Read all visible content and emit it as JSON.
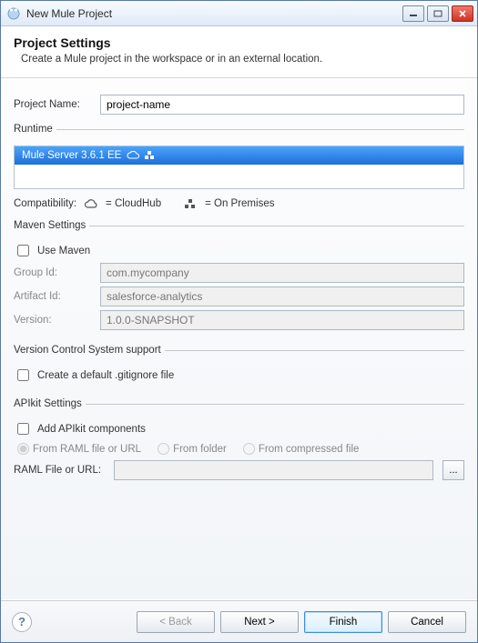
{
  "window": {
    "title": "New Mule Project"
  },
  "banner": {
    "heading": "Project Settings",
    "sub": "Create a Mule project in the workspace or in an external location."
  },
  "project_name": {
    "label": "Project Name:",
    "value": "project-name"
  },
  "runtime": {
    "legend": "Runtime",
    "selected": "Mule Server 3.6.1 EE"
  },
  "compat": {
    "label": "Compatibility:",
    "cloudhub": "= CloudHub",
    "onprem": "= On Premises"
  },
  "maven": {
    "legend": "Maven Settings",
    "use_label": "Use Maven",
    "group_label": "Group Id:",
    "group_value": "com.mycompany",
    "artifact_label": "Artifact Id:",
    "artifact_value": "salesforce-analytics",
    "version_label": "Version:",
    "version_value": "1.0.0-SNAPSHOT"
  },
  "vcs": {
    "legend": "Version Control System support",
    "gitignore_label": "Create a default .gitignore file"
  },
  "apikit": {
    "legend": "APIkit Settings",
    "add_label": "Add APIkit components",
    "radio_raml": "From RAML file or URL",
    "radio_folder": "From folder",
    "radio_zip": "From compressed file",
    "raml_label": "RAML File or URL:",
    "raml_value": "",
    "browse": "..."
  },
  "footer": {
    "back": "< Back",
    "next": "Next >",
    "finish": "Finish",
    "cancel": "Cancel"
  }
}
